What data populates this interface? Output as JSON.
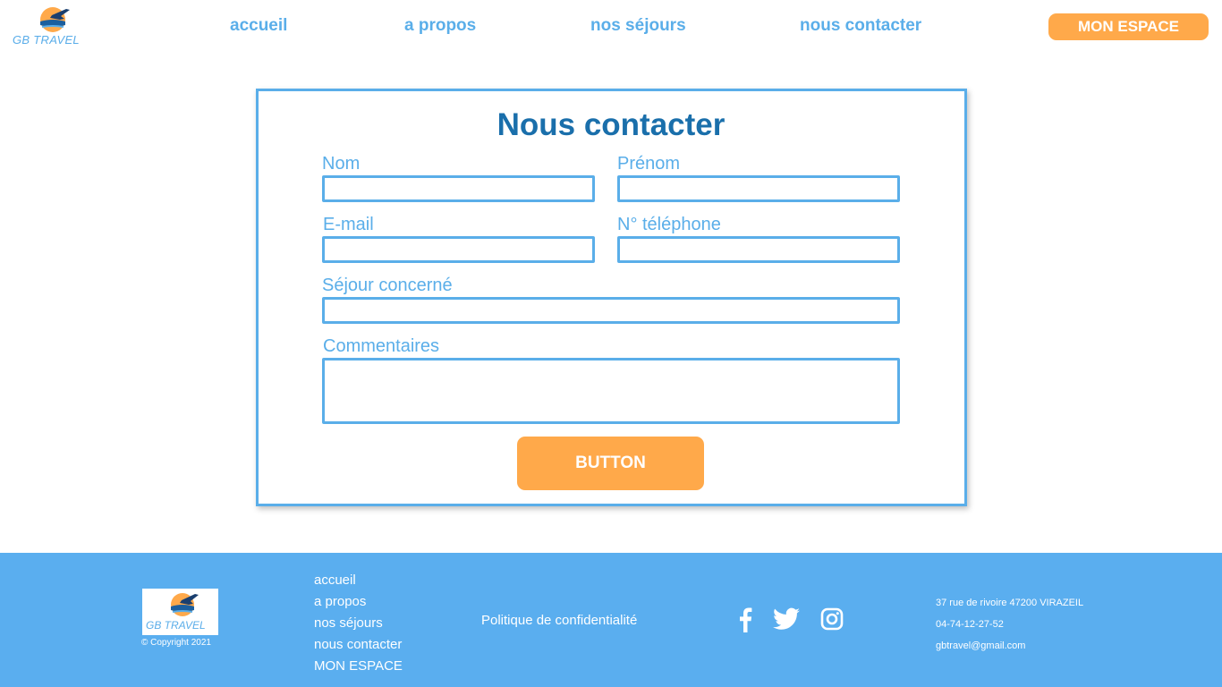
{
  "header": {
    "logo_text": "GB TRAVEL",
    "nav": {
      "accueil": "accueil",
      "apropos": "a propos",
      "sejours": "nos séjours",
      "contact": "nous contacter",
      "espace": "MON ESPACE"
    }
  },
  "form": {
    "title": "Nous contacter",
    "fields": {
      "nom": {
        "label": "Nom",
        "value": ""
      },
      "prenom": {
        "label": "Prénom",
        "value": ""
      },
      "email": {
        "label": "E-mail",
        "value": ""
      },
      "telephone": {
        "label": "N° téléphone",
        "value": ""
      },
      "sejour": {
        "label": "Séjour concerné",
        "value": ""
      },
      "commentaires": {
        "label": "Commentaires",
        "value": ""
      }
    },
    "submit_label": "BUTTON"
  },
  "footer": {
    "logo_text": "GB TRAVEL",
    "copyright": "© Copyright 2021",
    "nav": [
      "accueil",
      "a propos",
      "nos séjours",
      "nous contacter",
      "MON ESPACE"
    ],
    "policy": "Politique de confidentialité",
    "social": [
      "facebook-icon",
      "twitter-icon",
      "instagram-icon"
    ],
    "address": "37 rue de rivoire 47200 VIRAZEIL",
    "phone": "04-74-12-27-52",
    "email": "gbtravel@gmail.com"
  },
  "colors": {
    "primary": "#5aaee9",
    "title": "#1a6fab",
    "accent": "#ffa94a",
    "footer_bg": "#5aaeef"
  }
}
